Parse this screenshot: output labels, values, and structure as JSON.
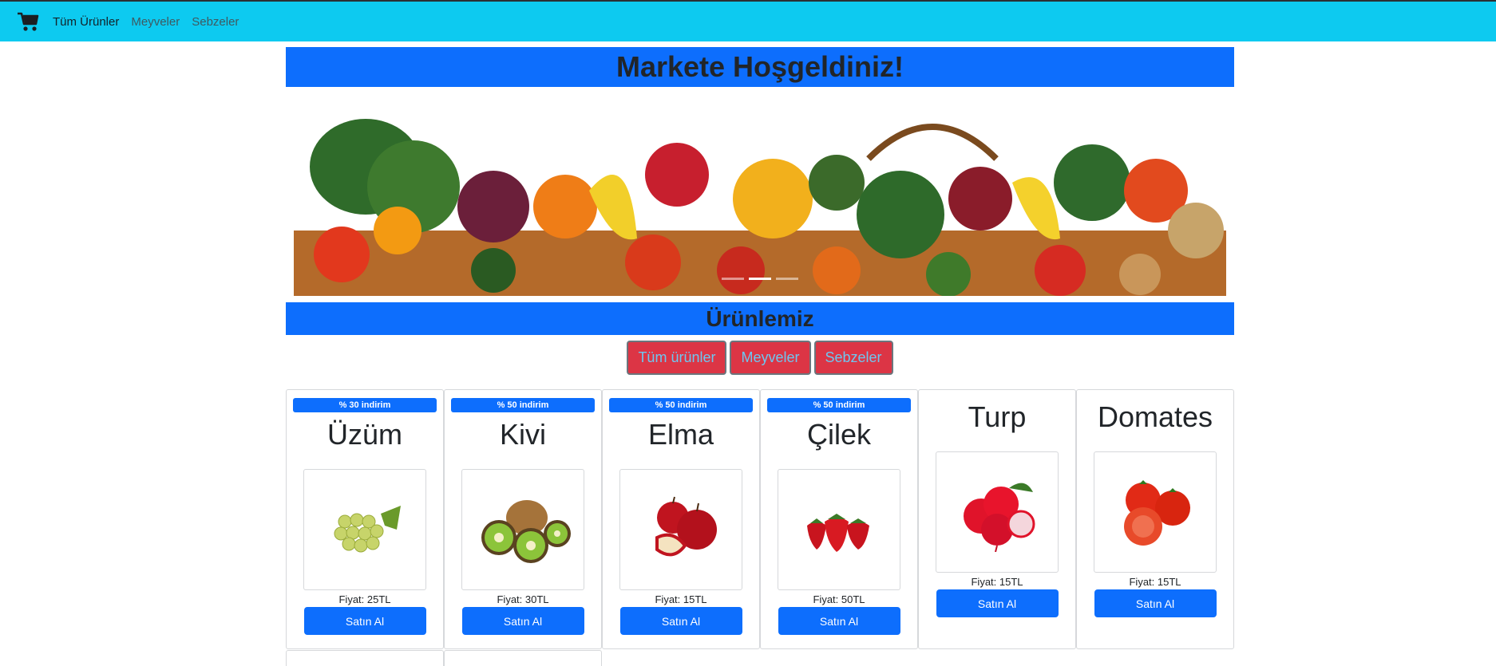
{
  "nav": {
    "brand_icon": "shopping-cart-icon",
    "links": [
      {
        "label": "Tüm Ürünler",
        "active": true
      },
      {
        "label": "Meyveler",
        "active": false
      },
      {
        "label": "Sebzeler",
        "active": false
      }
    ]
  },
  "header": {
    "title": "Markete Hoşgeldiniz!"
  },
  "carousel": {
    "indicator_count": 3,
    "active_index": 1
  },
  "products_section": {
    "title": "Ürünlemiz",
    "filters": [
      "Tüm ürünler",
      "Meyveler",
      "Sebzeler"
    ]
  },
  "products": [
    {
      "name": "Üzüm",
      "badge": "% 30 indirim",
      "price": "Fiyat: 25TL",
      "button": "Satın Al",
      "icon": "grapes-icon"
    },
    {
      "name": "Kivi",
      "badge": "% 50 indirim",
      "price": "Fiyat: 30TL",
      "button": "Satın Al",
      "icon": "kiwi-icon"
    },
    {
      "name": "Elma",
      "badge": "% 50 indirim",
      "price": "Fiyat: 15TL",
      "button": "Satın Al",
      "icon": "apple-icon"
    },
    {
      "name": "Çilek",
      "badge": "% 50 indirim",
      "price": "Fiyat: 50TL",
      "button": "Satın Al",
      "icon": "strawberry-icon"
    },
    {
      "name": "Turp",
      "badge": "",
      "price": "Fiyat: 15TL",
      "button": "Satın Al",
      "icon": "radish-icon"
    },
    {
      "name": "Domates",
      "badge": "",
      "price": "Fiyat: 15TL",
      "button": "Satın Al",
      "icon": "tomato-icon"
    }
  ],
  "colors": {
    "navbar": "#0dcaf0",
    "primary": "#0d6efd",
    "danger": "#dc3545"
  }
}
